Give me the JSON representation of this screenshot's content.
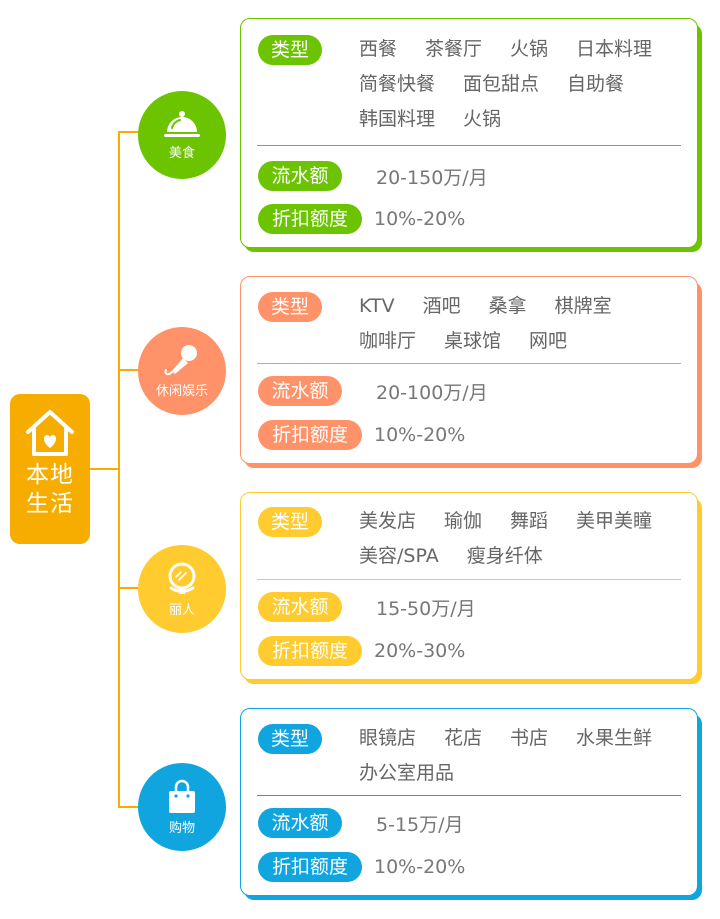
{
  "root": {
    "title_line1": "本地",
    "title_line2": "生活",
    "icon": "house-heart-icon",
    "color": "#f6ad00"
  },
  "categories": [
    {
      "label": "美食",
      "icon": "cloche-icon",
      "color": "#6cc400",
      "types_label": "类型",
      "types": [
        "西餐",
        "茶餐厅",
        "火锅",
        "日本料理",
        "简餐快餐",
        "面包甜点",
        "自助餐",
        "韩国料理",
        "火锅"
      ],
      "flow_label": "流水额",
      "flow_value": "20-150万/月",
      "discount_label": "折扣额度",
      "discount_value": "10%-20%"
    },
    {
      "label": "休闲娱乐",
      "icon": "microphone-icon",
      "color": "#ff9268",
      "types_label": "类型",
      "types": [
        "KTV",
        "酒吧",
        "桑拿",
        "棋牌室",
        "咖啡厅",
        "桌球馆",
        "网吧"
      ],
      "flow_label": "流水额",
      "flow_value": "20-100万/月",
      "discount_label": "折扣额度",
      "discount_value": "10%-20%"
    },
    {
      "label": "丽人",
      "icon": "mirror-icon",
      "color": "#ffcb2f",
      "types_label": "类型",
      "types": [
        "美发店",
        "瑜伽",
        "舞蹈",
        "美甲美瞳",
        "美容/SPA",
        "瘦身纤体"
      ],
      "flow_label": "流水额",
      "flow_value": "15-50万/月",
      "discount_label": "折扣额度",
      "discount_value": "20%-30%"
    },
    {
      "label": "购物",
      "icon": "shopping-bag-icon",
      "color": "#11a5e0",
      "types_label": "类型",
      "types": [
        "眼镜店",
        "花店",
        "书店",
        "水果生鲜",
        "办公室用品"
      ],
      "flow_label": "流水额",
      "flow_value": "5-15万/月",
      "discount_label": "折扣额度",
      "discount_value": "10%-20%"
    }
  ]
}
